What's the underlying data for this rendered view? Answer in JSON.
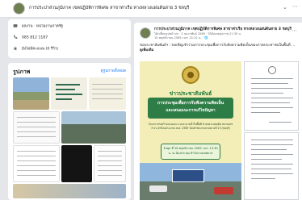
{
  "header": {
    "page_title": "การประปาส่วนภูมิภาค เขตปฏิบัติการพิเศษ สาขาท่าเรือ ทางหลวงแผ่นดินสาย 3 ชลบุรี"
  },
  "intro": {
    "category": "ผลงาน · หน่วยงานภาครัฐ",
    "phone": "085 812 1187",
    "rating": "ยังไม่มีคะแนน (0 รีวิว)"
  },
  "photos": {
    "title": "รูปภาพ",
    "see_all": "ดูรูปภาพทั้งหมด"
  },
  "post": {
    "author": "การประปาส่วนภูมิภาค เขตปฏิบัติการพิเศษ สาขาท่าเรือ ทางหลวงแผ่นดินสาย 3 ชลบุรี",
    "meta_line1": "ได้เปลี่ยนรูปหน้าปก · 2 กุมภาพันธ์ 2565 · ได้อัปเดตรูปภาพ 21:35 น.",
    "meta_line2": "10 พฤศจิกายน 2565 เวลา 21:21 น. · 🌐",
    "text": "ขอประชาสัมพันธ์ฯ : ขอเชิญเข้าร่วมการประชุมเพื่อการรับฟังความคิดเห็นของภาคประชาชนในพื้นที่ ...",
    "see_more": "ดูเพิ่มเติม"
  },
  "poster": {
    "news": "ข่าวประชาสัมพันธ์",
    "headline1": "การประชุมเพื่อการรับฟังความคิดเห็น",
    "headline2": "และเสนอแนะการแก้ไขปัญหา",
    "body": "โครงการก่อสร้างถนนและระบบระบายน้ำในพื้นที่ ทางหลวงแผ่นดิน หมายเลข 3 ประจำปีงบประมาณ พ.ศ. 2565 โดยสำนักงานทางหลวงที่ 13 (ชลบุรี)",
    "date_box": "วันพุธ ที่ 16 พฤศจิกายน 2565 เวลา 13.30 น. ณ ห้องประชุม สำนักงานเทศบาล"
  },
  "colors": {
    "link": "#1877f2",
    "poster_green": "#2e7d46",
    "poster_bg": "#f3edb7"
  }
}
